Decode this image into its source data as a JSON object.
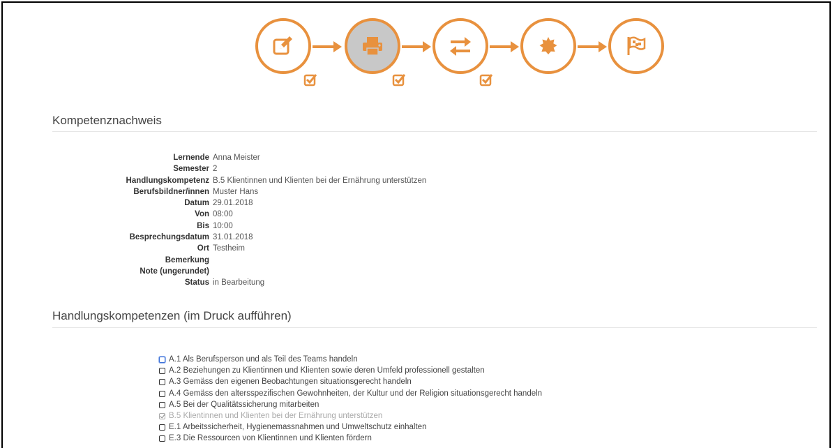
{
  "colors": {
    "accent": "#e8913e",
    "active_step_bg": "#c8c8c8"
  },
  "workflow": {
    "steps": [
      {
        "icon": "edit-icon",
        "active": false,
        "done": true
      },
      {
        "icon": "print-icon",
        "active": true,
        "done": true
      },
      {
        "icon": "exchange-icon",
        "active": false,
        "done": true
      },
      {
        "icon": "certificate-icon",
        "active": false,
        "done": false
      },
      {
        "icon": "flag-icon",
        "active": false,
        "done": false
      }
    ]
  },
  "section1": {
    "title": "Kompetenznachweis"
  },
  "details": [
    {
      "label": "Lernende",
      "value": "Anna Meister"
    },
    {
      "label": "Semester",
      "value": "2"
    },
    {
      "label": "Handlungskompetenz",
      "value": "B.5 Klientinnen und Klienten bei der Ernährung unterstützen"
    },
    {
      "label": "Berufsbildner/innen",
      "value": "Muster Hans"
    },
    {
      "label": "Datum",
      "value": "29.01.2018"
    },
    {
      "label": "Von",
      "value": "08:00"
    },
    {
      "label": "Bis",
      "value": "10:00"
    },
    {
      "label": "Besprechungsdatum",
      "value": "31.01.2018"
    },
    {
      "label": "Ort",
      "value": "Testheim"
    },
    {
      "label": "Bemerkung",
      "value": ""
    },
    {
      "label": "Note (ungerundet)",
      "value": ""
    },
    {
      "label": "Status",
      "value": "in Bearbeitung"
    }
  ],
  "section2": {
    "title": "Handlungskompetenzen (im Druck aufführen)"
  },
  "competencies": [
    {
      "label": "A.1 Als Berufsperson und als Teil des Teams handeln",
      "checked": false,
      "disabled": false,
      "focused": true
    },
    {
      "label": "A.2 Beziehungen zu Klientinnen und Klienten sowie deren Umfeld professionell gestalten",
      "checked": false,
      "disabled": false
    },
    {
      "label": "A.3 Gemäss den eigenen Beobachtungen situationsgerecht handeln",
      "checked": false,
      "disabled": false
    },
    {
      "label": "A.4 Gemäss den altersspezifischen Gewohnheiten, der Kultur und der Religion situationsgerecht handeln",
      "checked": false,
      "disabled": false
    },
    {
      "label": "A.5 Bei der Qualitätssicherung mitarbeiten",
      "checked": false,
      "disabled": false
    },
    {
      "label": "B.5 Klientinnen und Klienten bei der Ernährung unterstützen",
      "checked": true,
      "disabled": true
    },
    {
      "label": "E.1 Arbeitssicherheit, Hygienemassnahmen und Umweltschutz einhalten",
      "checked": false,
      "disabled": false
    },
    {
      "label": "E.3 Die Ressourcen von Klientinnen und Klienten fördern",
      "checked": false,
      "disabled": false
    }
  ]
}
